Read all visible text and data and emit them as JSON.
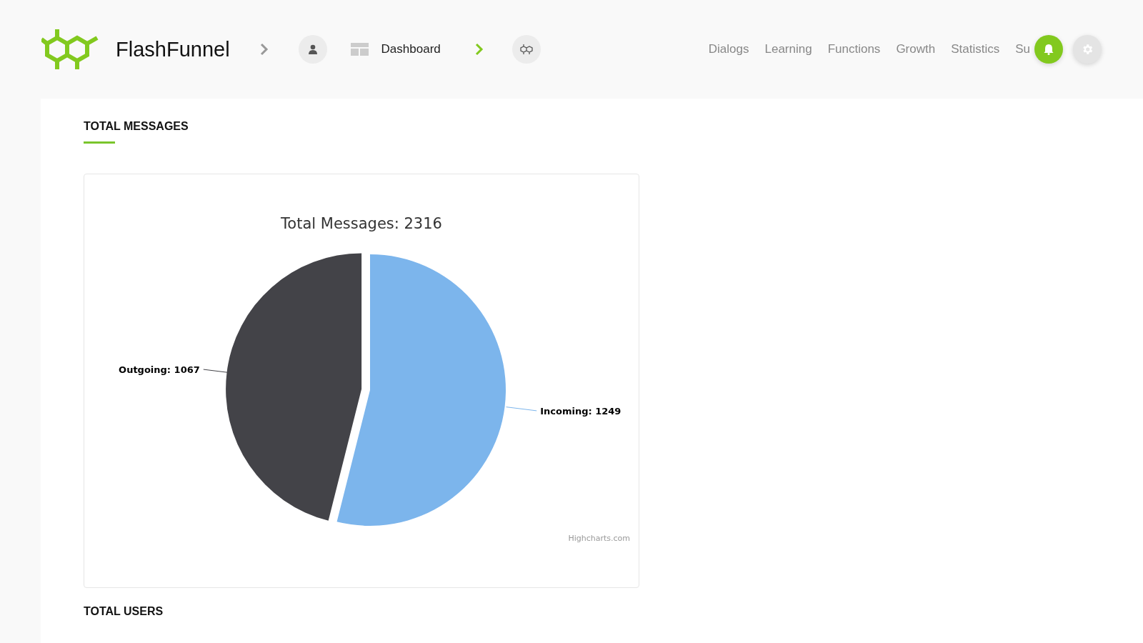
{
  "header": {
    "brand": "FlashFunnel",
    "breadcrumb": "Dashboard",
    "nav": [
      {
        "label": "Dialogs"
      },
      {
        "label": "Learning"
      },
      {
        "label": "Functions"
      },
      {
        "label": "Growth"
      },
      {
        "label": "Statistics"
      },
      {
        "label": "Su"
      }
    ]
  },
  "sections": [
    {
      "title": "TOTAL MESSAGES",
      "chart_data": {
        "type": "pie",
        "title": "Total Messages: 2316",
        "categories": [
          "Incoming",
          "Outgoing"
        ],
        "values": [
          1249,
          1067
        ],
        "data_labels": true,
        "value_labels": [
          "1249",
          "1067"
        ]
      },
      "label_separator": ":",
      "slices": [
        {
          "color": "#7cb5ec"
        },
        {
          "color": "#434348"
        }
      ],
      "credit": "Highcharts.com"
    },
    {
      "title": "TOTAL USERS"
    }
  ]
}
